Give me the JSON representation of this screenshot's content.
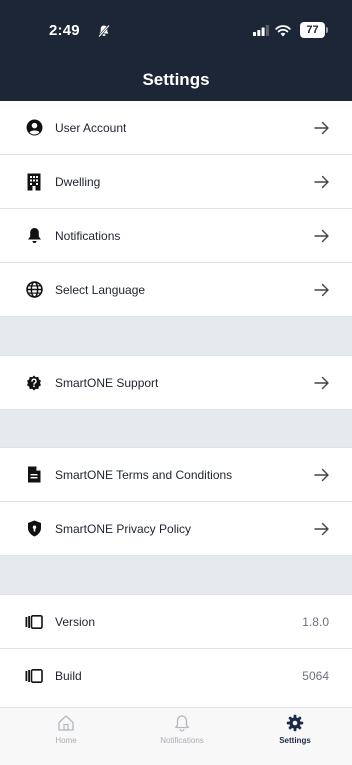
{
  "status_bar": {
    "time": "2:49",
    "battery": "77"
  },
  "header": {
    "title": "Settings"
  },
  "items": [
    {
      "label": "User Account",
      "icon": "user-circle-icon"
    },
    {
      "label": "Dwelling",
      "icon": "building-icon"
    },
    {
      "label": "Notifications",
      "icon": "bell-icon"
    },
    {
      "label": "Select Language",
      "icon": "globe-icon"
    },
    {
      "label": "SmartONE Support",
      "icon": "question-badge-icon"
    },
    {
      "label": "SmartONE Terms and Conditions",
      "icon": "document-icon"
    },
    {
      "label": "SmartONE Privacy Policy",
      "icon": "shield-icon"
    }
  ],
  "info": [
    {
      "label": "Version",
      "value": "1.8.0",
      "icon": "device-icon"
    },
    {
      "label": "Build",
      "value": "5064",
      "icon": "device-icon"
    }
  ],
  "tabs": [
    {
      "label": "Home",
      "icon": "home-icon",
      "active": false
    },
    {
      "label": "Notifications",
      "icon": "bell-outline-icon",
      "active": false
    },
    {
      "label": "Settings",
      "icon": "gear-icon",
      "active": true
    }
  ],
  "colors": {
    "header_bg": "#1c2637",
    "section_gap": "#e6e9ee",
    "active_tab": "#1c2a4a",
    "inactive_tab": "#a8adb6"
  }
}
